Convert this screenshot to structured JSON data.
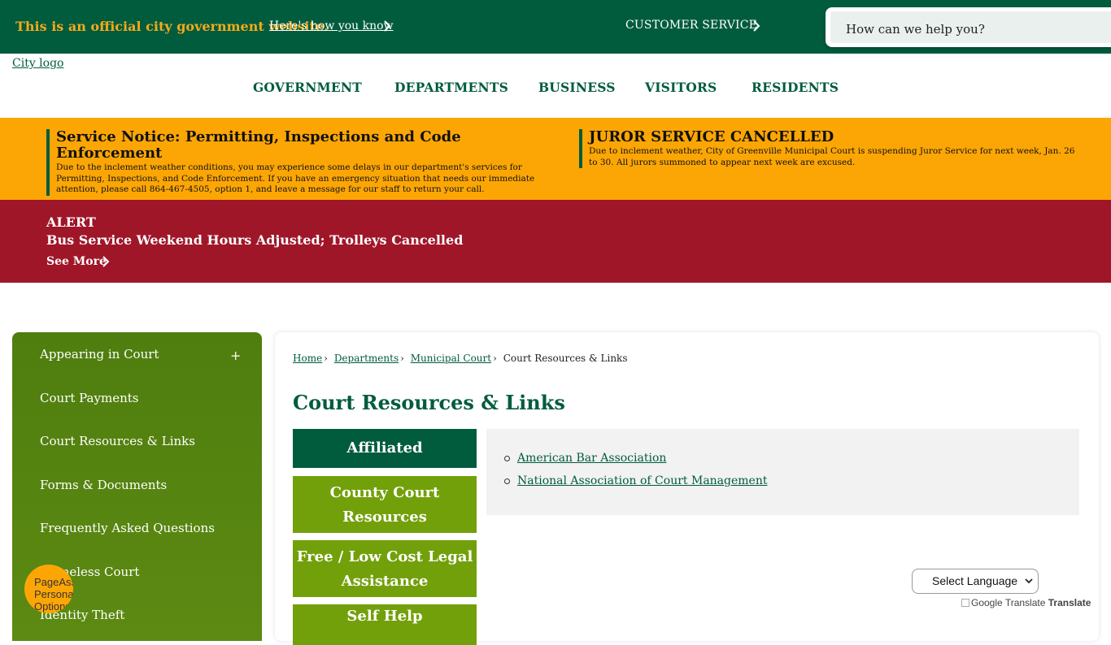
{
  "topbar": {
    "official": "This is an official city government website.",
    "how_know": "Here's how you know",
    "customer_service": "CUSTOMER SERVICE",
    "search_placeholder": "How can we help you?"
  },
  "header": {
    "logo_alt": "City logo",
    "nav": [
      "GOVERNMENT",
      "DEPARTMENTS",
      "BUSINESS",
      "VISITORS",
      "RESIDENTS"
    ]
  },
  "notices": [
    {
      "title": "Service Notice: Permitting, Inspections and Code Enforcement",
      "body": "Due to the inclement weather conditions, you may experience some delays in our department's services for Permitting, Inspections, and Code Enforcement. If you have an emergency situation that needs our immediate attention, please call 864-467-4505, option 1, and leave a message for our staff to return your call."
    },
    {
      "title": "JUROR SERVICE CANCELLED",
      "body": "Due to inclement weather, City of Greenville Municipal Court is suspending Juror Service for next week, Jan. 26 to 30. All jurors summoned to appear next week are excused."
    }
  ],
  "alert": {
    "title": "ALERT",
    "text": "Bus Service Weekend Hours Adjusted; Trolleys Cancelled",
    "see_more": "See More"
  },
  "sidebar": {
    "items": [
      "Appearing in Court",
      "Court Payments",
      "Court Resources & Links",
      "Forms & Documents",
      "Frequently Asked Questions",
      "Homeless Court",
      "Identity Theft"
    ],
    "expand_symbol": "+"
  },
  "breadcrumb": [
    "Home",
    "Departments",
    "Municipal Court",
    "Court Resources & Links"
  ],
  "page_title": "Court Resources & Links",
  "tabs": [
    "Affiliated Organizations",
    "County Court Resources",
    "Free / Low Cost Legal Assistance",
    "Self Help"
  ],
  "panel_links": [
    "American Bar Association",
    "National Association of Court Management"
  ],
  "translate": {
    "select_label": "Select Language",
    "powered": "Google Translate",
    "translate_word": "Translate"
  },
  "widget": {
    "alt": "PageAssist Personalization Options"
  },
  "colors": {
    "brand_green": "#005c3d",
    "notice_orange": "#fca605",
    "alert_red": "#9f1629",
    "tab_green": "#72a00a"
  }
}
